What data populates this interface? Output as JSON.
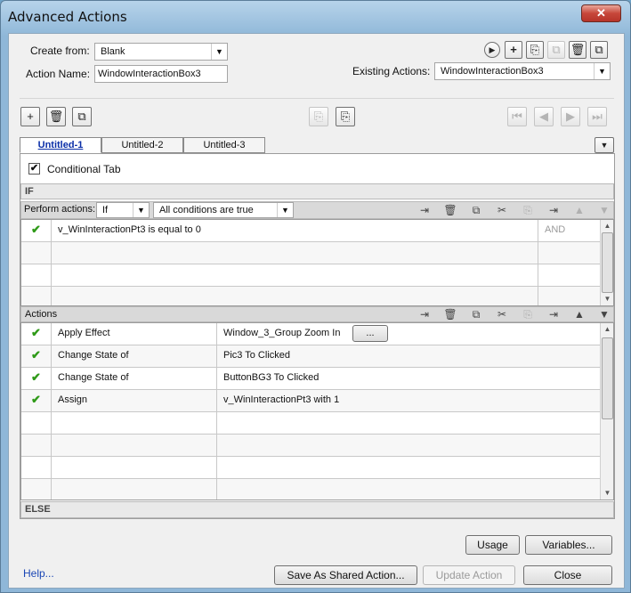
{
  "window": {
    "title": "Advanced Actions"
  },
  "header": {
    "create_from_label": "Create from:",
    "create_from_value": "Blank",
    "action_name_label": "Action Name:",
    "action_name_value": "WindowInteractionBox3",
    "existing_actions_label": "Existing Actions:",
    "existing_actions_value": "WindowInteractionBox3"
  },
  "tabs": [
    {
      "label": "Untitled-1",
      "active": true
    },
    {
      "label": "Untitled-2",
      "active": false
    },
    {
      "label": "Untitled-3",
      "active": false
    }
  ],
  "conditional": {
    "checkbox_label": "Conditional Tab",
    "checked": true
  },
  "if_section": {
    "label": "IF",
    "perform_actions_label": "Perform actions:",
    "perform_value": "If",
    "condition_mode": "All conditions are true",
    "rows": [
      {
        "checked": true,
        "expr": "v_WinInteractionPt3    is equal to    0",
        "op": "AND"
      },
      {
        "checked": false,
        "expr": "",
        "op": ""
      },
      {
        "checked": false,
        "expr": "",
        "op": ""
      },
      {
        "checked": false,
        "expr": "",
        "op": ""
      }
    ]
  },
  "actions_section": {
    "label": "Actions",
    "more_button": "...",
    "rows": [
      {
        "checked": true,
        "action": "Apply Effect",
        "target": "Window_3_Group    Zoom In",
        "has_more": true
      },
      {
        "checked": true,
        "action": "Change State of",
        "target": "Pic3    To    Clicked",
        "has_more": false
      },
      {
        "checked": true,
        "action": "Change State of",
        "target": "ButtonBG3    To    Clicked",
        "has_more": false
      },
      {
        "checked": true,
        "action": "Assign",
        "target": "v_WinInteractionPt3    with    1",
        "has_more": false
      },
      {
        "checked": false,
        "action": "",
        "target": "",
        "has_more": false
      },
      {
        "checked": false,
        "action": "",
        "target": "",
        "has_more": false
      },
      {
        "checked": false,
        "action": "",
        "target": "",
        "has_more": false
      },
      {
        "checked": false,
        "action": "",
        "target": "",
        "has_more": false
      }
    ]
  },
  "else_section": {
    "label": "ELSE"
  },
  "footer": {
    "help_link": "Help...",
    "usage_button": "Usage",
    "variables_button": "Variables...",
    "save_shared_button": "Save As Shared Action...",
    "update_button": "Update Action",
    "close_button": "Close"
  },
  "icons": {
    "check": "✔",
    "dropdown": "▼",
    "play": "▶",
    "add": "+",
    "trash": "🗑",
    "copy": "⧉",
    "cut": "✂",
    "paste": "⎘",
    "insert": "⇥",
    "up": "▲",
    "down": "▼",
    "first": "⏮",
    "prev": "◀",
    "next": "▶",
    "last": "⏭"
  },
  "colors": {
    "active_tab": "#0b2fa8",
    "check": "#2f9a18",
    "link": "#1a46b5"
  }
}
